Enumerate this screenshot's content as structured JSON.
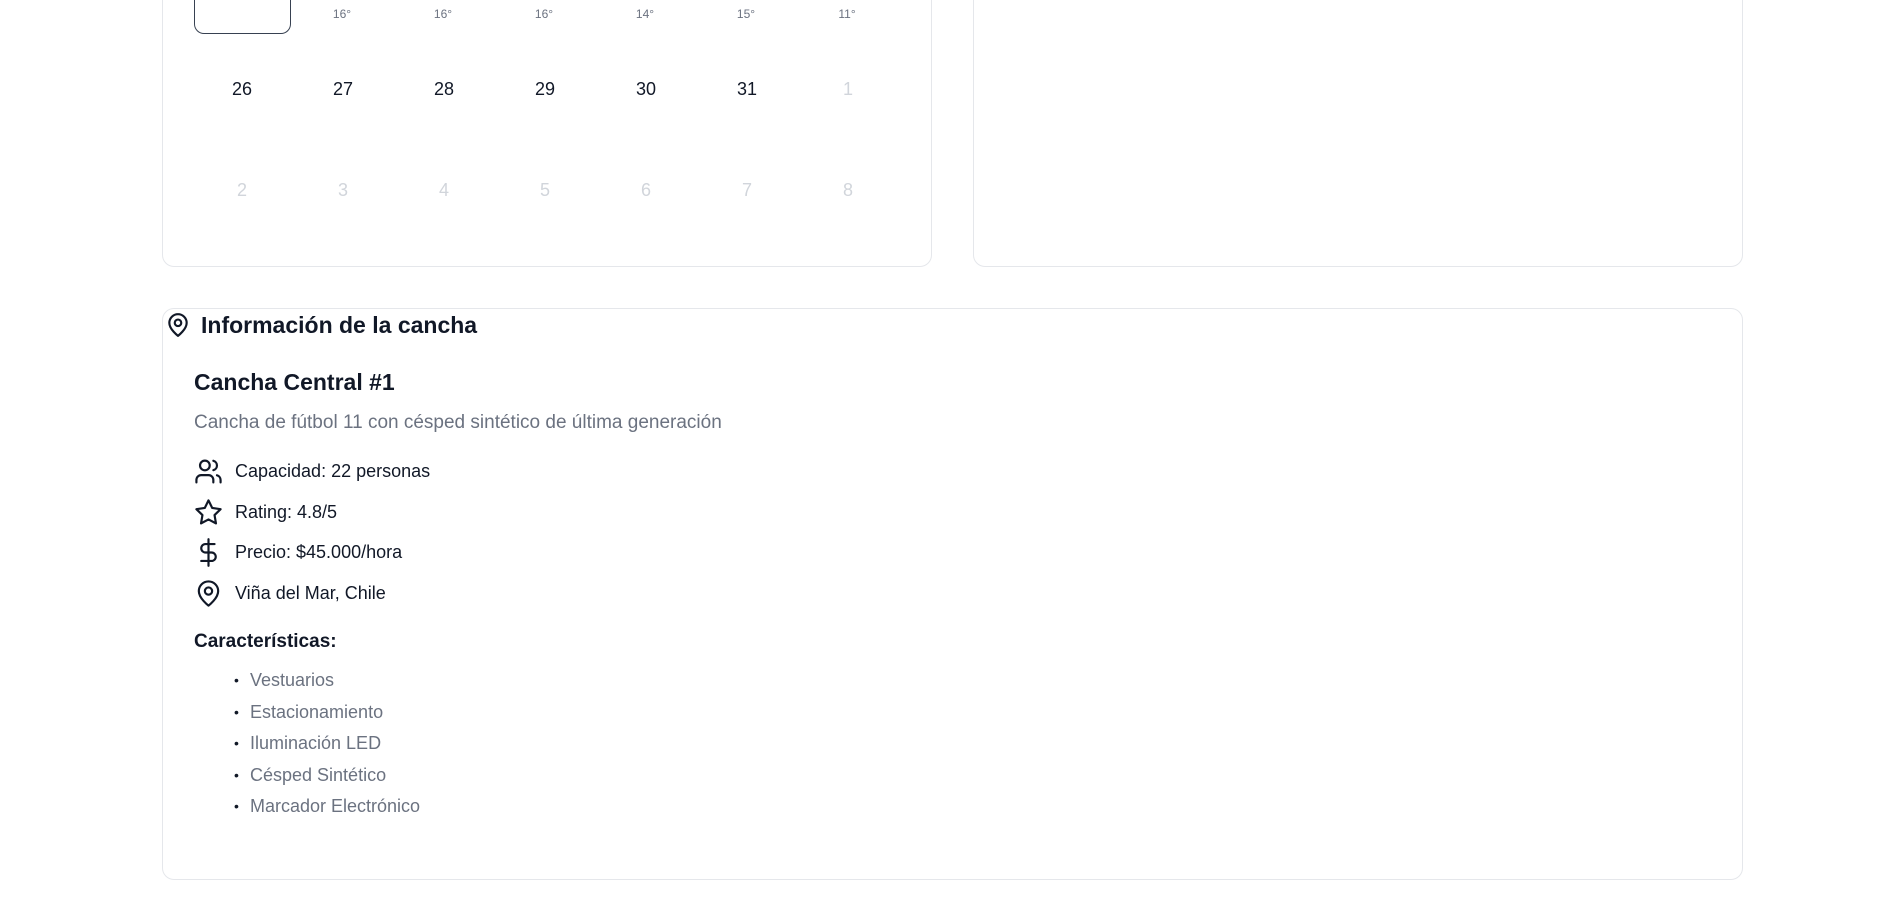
{
  "calendar": {
    "temps": [
      "16°",
      "16°",
      "16°",
      "14°",
      "15°",
      "11°"
    ],
    "week1": [
      {
        "day": "26",
        "muted": false
      },
      {
        "day": "27",
        "muted": false
      },
      {
        "day": "28",
        "muted": false
      },
      {
        "day": "29",
        "muted": false
      },
      {
        "day": "30",
        "muted": false
      },
      {
        "day": "31",
        "muted": false
      },
      {
        "day": "1",
        "muted": true
      }
    ],
    "week2": [
      {
        "day": "2",
        "muted": true
      },
      {
        "day": "3",
        "muted": true
      },
      {
        "day": "4",
        "muted": true
      },
      {
        "day": "5",
        "muted": true
      },
      {
        "day": "6",
        "muted": true
      },
      {
        "day": "7",
        "muted": true
      },
      {
        "day": "8",
        "muted": true
      }
    ]
  },
  "info": {
    "section_title": "Información de la cancha",
    "field_name": "Cancha Central #1",
    "description": "Cancha de fútbol 11 con césped sintético de última generación",
    "capacity": "Capacidad: 22 personas",
    "rating": "Rating: 4.8/5",
    "price": "Precio: $45.000/hora",
    "location": "Viña del Mar, Chile",
    "features_heading": "Características:",
    "features": [
      "Vestuarios",
      "Estacionamiento",
      "Iluminación LED",
      "Césped Sintético",
      "Marcador Electrónico"
    ]
  },
  "icons": {
    "section": "map-pin-icon",
    "capacity": "users-icon",
    "rating": "star-icon",
    "price": "dollar-sign-icon",
    "location": "map-pin-icon"
  },
  "colors": {
    "text": "#111827",
    "muted_text": "#6b7280",
    "disabled_day": "#d1d5db",
    "border": "#e5e7eb"
  }
}
